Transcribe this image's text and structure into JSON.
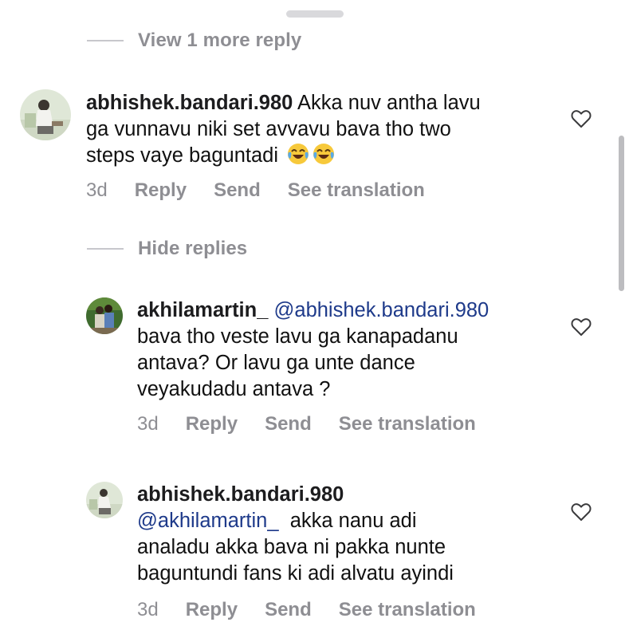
{
  "thread1": {
    "toggle_label": "View 1 more reply"
  },
  "comment1": {
    "username": "abhishek.bandari.980",
    "text_line1": " Akka nuv antha lavu",
    "text_line2": "ga vunnavu niki set avvavu bava tho two",
    "text_line3": "steps vaye baguntadi",
    "emoji": "😂😂",
    "time": "3d",
    "reply_label": "Reply",
    "send_label": "Send",
    "translate_label": "See translation"
  },
  "thread2": {
    "toggle_label": "Hide replies"
  },
  "reply1": {
    "username": "akhilamartin_",
    "mention": "@abhishek.bandari.980",
    "text_line1": "bava tho veste lavu ga kanapadanu",
    "text_line2": "antava? Or lavu ga unte dance",
    "text_line3": "veyakudadu antava ?",
    "time": "3d",
    "reply_label": "Reply",
    "send_label": "Send",
    "translate_label": "See translation"
  },
  "reply2": {
    "username": "abhishek.bandari.980",
    "mention": "@akhilamartin_",
    "text_line1": "  akka nanu adi",
    "text_line2": "analadu akka bava ni pakka nunte",
    "text_line3": "baguntundi fans ki adi alvatu ayindi",
    "time": "3d",
    "reply_label": "Reply",
    "send_label": "Send",
    "translate_label": "See translation"
  },
  "colors": {
    "text": "#111111",
    "secondary": "#8e8e93",
    "mention": "#1e3a8a",
    "divider": "#c7c7cc"
  },
  "icons": {
    "like": "heart-outline-icon",
    "emoji": "face-with-tears-of-joy"
  }
}
